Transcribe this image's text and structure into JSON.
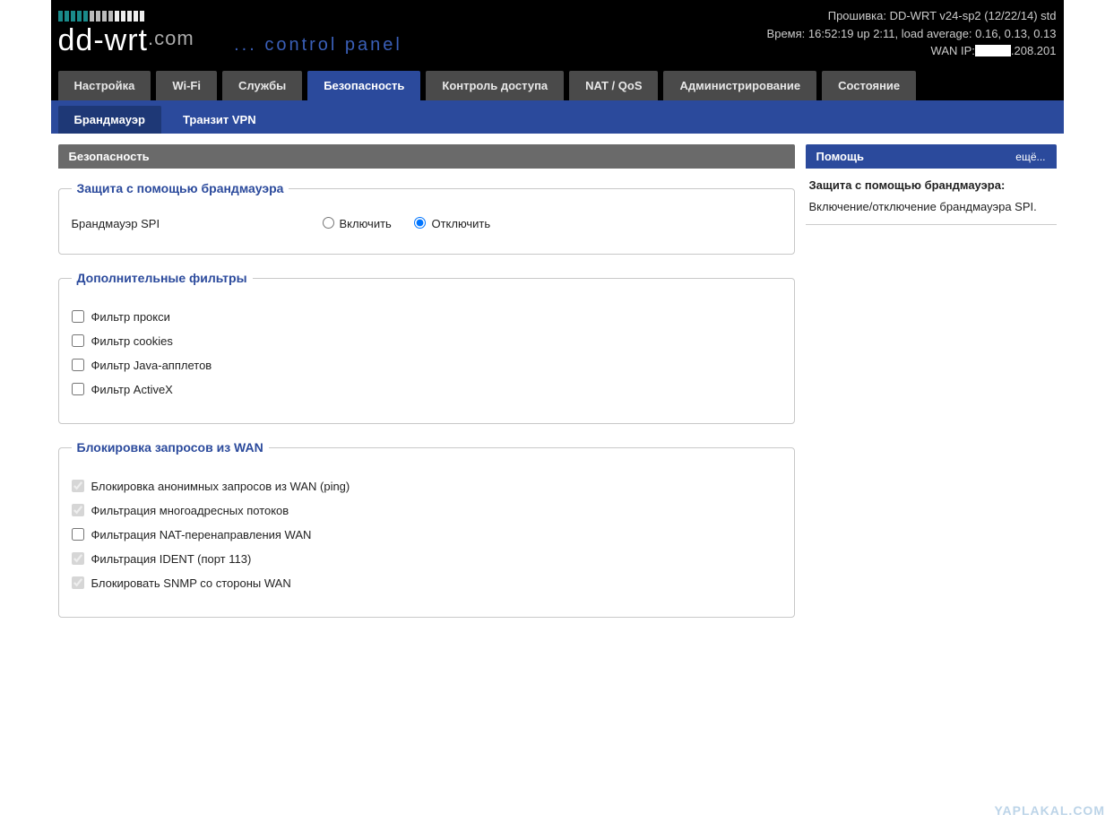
{
  "header": {
    "logo_main": "dd-wrt",
    "logo_suffix": ".com",
    "subtitle": "... control panel",
    "firmware_label": "Прошивка:",
    "firmware_value": "DD-WRT v24-sp2 (12/22/14) std",
    "time_label": "Время:",
    "time_value": "16:52:19 up 2:11, load average: 0.16, 0.13, 0.13",
    "wanip_label": "WAN IP:",
    "wanip_value": ".208.201"
  },
  "tabs": {
    "main": [
      "Настройка",
      "Wi-Fi",
      "Службы",
      "Безопасность",
      "Контроль доступа",
      "NAT / QoS",
      "Администрирование",
      "Состояние"
    ],
    "main_active": 3,
    "sub": [
      "Брандмауэр",
      "Транзит VPN"
    ],
    "sub_active": 0
  },
  "section_title": "Безопасность",
  "firewall": {
    "legend": "Защита с помощью брандмауэра",
    "spi_label": "Брандмауэр SPI",
    "enable": "Включить",
    "disable": "Отключить",
    "disabled_selected": true
  },
  "filters": {
    "legend": "Дополнительные фильтры",
    "items": [
      {
        "label": "Фильтр прокси",
        "checked": false
      },
      {
        "label": "Фильтр cookies",
        "checked": false
      },
      {
        "label": "Фильтр Java-апплетов",
        "checked": false
      },
      {
        "label": "Фильтр ActiveX",
        "checked": false
      }
    ]
  },
  "wanblock": {
    "legend": "Блокировка запросов из WAN",
    "items": [
      {
        "label": "Блокировка анонимных запросов из WAN (ping)",
        "checked": true,
        "disabled": true
      },
      {
        "label": "Фильтрация многоадресных потоков",
        "checked": true,
        "disabled": true
      },
      {
        "label": "Фильтрация NAT-перенаправления WAN",
        "checked": false,
        "disabled": false
      },
      {
        "label": "Фильтрация IDENT (порт 113)",
        "checked": true,
        "disabled": true
      },
      {
        "label": "Блокировать SNMP со стороны WAN",
        "checked": true,
        "disabled": true
      }
    ]
  },
  "help": {
    "header": "Помощь",
    "more": "ещё...",
    "title": "Защита с помощью брандмауэра:",
    "text": "Включение/отключение брандмауэра SPI."
  },
  "watermark": "YAPLAKAL.COM"
}
